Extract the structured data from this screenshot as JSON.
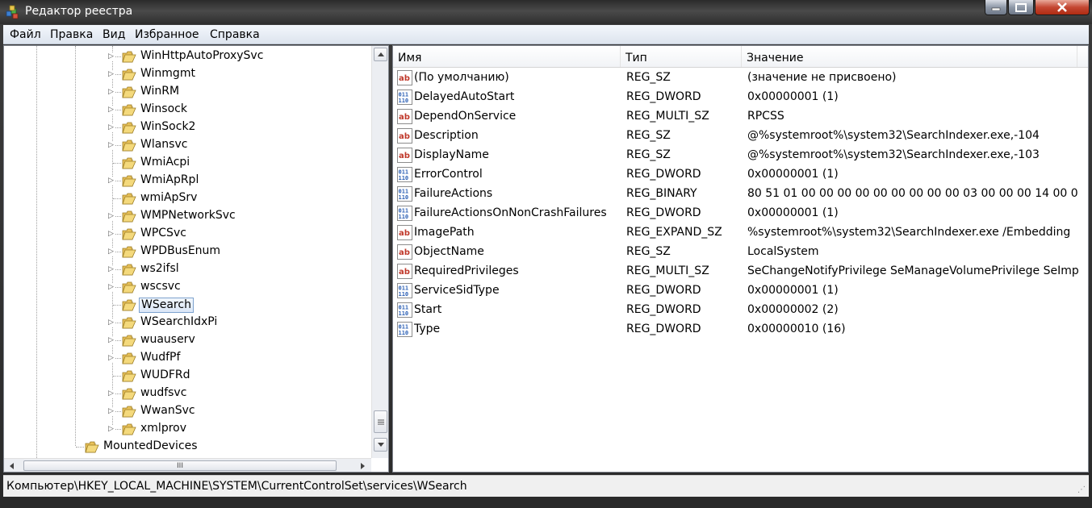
{
  "window": {
    "title": "Редактор реестра",
    "icon": "regedit-icon"
  },
  "menu": [
    "Файл",
    "Правка",
    "Вид",
    "Избранное",
    "Справка"
  ],
  "tree": {
    "items": [
      {
        "label": "WinHttpAutoProxySvc",
        "expandable": true
      },
      {
        "label": "Winmgmt",
        "expandable": true
      },
      {
        "label": "WinRM",
        "expandable": true
      },
      {
        "label": "Winsock",
        "expandable": true
      },
      {
        "label": "WinSock2",
        "expandable": true
      },
      {
        "label": "Wlansvc",
        "expandable": true
      },
      {
        "label": "WmiAcpi",
        "expandable": false
      },
      {
        "label": "WmiApRpl",
        "expandable": true
      },
      {
        "label": "wmiApSrv",
        "expandable": false
      },
      {
        "label": "WMPNetworkSvc",
        "expandable": true
      },
      {
        "label": "WPCSvc",
        "expandable": true
      },
      {
        "label": "WPDBusEnum",
        "expandable": true
      },
      {
        "label": "ws2ifsl",
        "expandable": true
      },
      {
        "label": "wscsvc",
        "expandable": true
      },
      {
        "label": "WSearch",
        "expandable": false,
        "selected": true
      },
      {
        "label": "WSearchIdxPi",
        "expandable": true
      },
      {
        "label": "wuauserv",
        "expandable": true
      },
      {
        "label": "WudfPf",
        "expandable": true
      },
      {
        "label": "WUDFRd",
        "expandable": false
      },
      {
        "label": "wudfsvc",
        "expandable": true
      },
      {
        "label": "WwanSvc",
        "expandable": true
      },
      {
        "label": "xmlprov",
        "expandable": true
      }
    ],
    "parent_item": {
      "label": "MountedDevices"
    },
    "hscroll_grip": "III"
  },
  "columns": {
    "name": "Имя",
    "type": "Тип",
    "value": "Значение"
  },
  "values": [
    {
      "icon": "string-value-icon",
      "name": "(По умолчанию)",
      "type": "REG_SZ",
      "data": "(значение не присвоено)"
    },
    {
      "icon": "binary-value-icon",
      "name": "DelayedAutoStart",
      "type": "REG_DWORD",
      "data": "0x00000001 (1)"
    },
    {
      "icon": "string-value-icon",
      "name": "DependOnService",
      "type": "REG_MULTI_SZ",
      "data": "RPCSS"
    },
    {
      "icon": "string-value-icon",
      "name": "Description",
      "type": "REG_SZ",
      "data": "@%systemroot%\\system32\\SearchIndexer.exe,-104"
    },
    {
      "icon": "string-value-icon",
      "name": "DisplayName",
      "type": "REG_SZ",
      "data": "@%systemroot%\\system32\\SearchIndexer.exe,-103"
    },
    {
      "icon": "binary-value-icon",
      "name": "ErrorControl",
      "type": "REG_DWORD",
      "data": "0x00000001 (1)"
    },
    {
      "icon": "binary-value-icon",
      "name": "FailureActions",
      "type": "REG_BINARY",
      "data": "80 51 01 00 00 00 00 00 00 00 00 00 03 00 00 00 14 00 00 0..."
    },
    {
      "icon": "binary-value-icon",
      "name": "FailureActionsOnNonCrashFailures",
      "type": "REG_DWORD",
      "data": "0x00000001 (1)"
    },
    {
      "icon": "string-value-icon",
      "name": "ImagePath",
      "type": "REG_EXPAND_SZ",
      "data": "%systemroot%\\system32\\SearchIndexer.exe /Embedding"
    },
    {
      "icon": "string-value-icon",
      "name": "ObjectName",
      "type": "REG_SZ",
      "data": "LocalSystem"
    },
    {
      "icon": "string-value-icon",
      "name": "RequiredPrivileges",
      "type": "REG_MULTI_SZ",
      "data": "SeChangeNotifyPrivilege SeManageVolumePrivilege SeImp..."
    },
    {
      "icon": "binary-value-icon",
      "name": "ServiceSidType",
      "type": "REG_DWORD",
      "data": "0x00000001 (1)"
    },
    {
      "icon": "binary-value-icon",
      "name": "Start",
      "type": "REG_DWORD",
      "data": "0x00000002 (2)"
    },
    {
      "icon": "binary-value-icon",
      "name": "Type",
      "type": "REG_DWORD",
      "data": "0x00000010 (16)"
    }
  ],
  "status": {
    "path": "Компьютер\\HKEY_LOCAL_MACHINE\\SYSTEM\\CurrentControlSet\\services\\WSearch"
  },
  "colors": {
    "selection_border": "#7da2ce",
    "folder": "#e8c15a",
    "string_icon": "#c0392b",
    "binary_icon": "#2b5fb4"
  }
}
